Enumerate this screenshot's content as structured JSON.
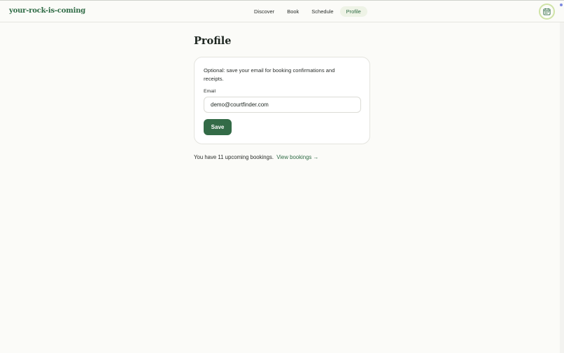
{
  "header": {
    "brand": "your-rock-is-coming",
    "nav": [
      {
        "label": "Discover"
      },
      {
        "label": "Book"
      },
      {
        "label": "Schedule"
      },
      {
        "label": "Profile",
        "active": true
      }
    ],
    "calendar_icon": "calendar-icon"
  },
  "page": {
    "title": "Profile"
  },
  "card": {
    "description": "Optional: save your email for booking confirmations and receipts.",
    "email_label": "Email",
    "email_value": "demo@courtfinder.com",
    "save_label": "Save"
  },
  "footer": {
    "bookings_text": "You have 11 upcoming bookings.",
    "view_link": "View bookings →"
  },
  "colors": {
    "accent": "#336b47",
    "active_nav_bg": "#eef3e6",
    "background": "#fbfbf8"
  }
}
